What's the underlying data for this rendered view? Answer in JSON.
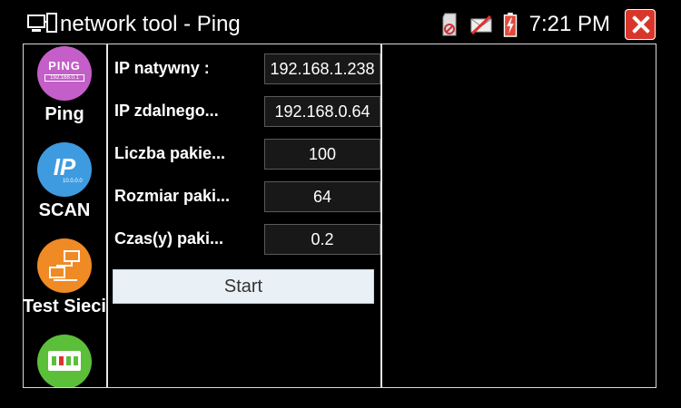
{
  "window": {
    "title": "network tool - Ping"
  },
  "status_bar": {
    "time": "7:21 PM",
    "icons": [
      "sd-card-icon",
      "mail-off-icon",
      "battery-charging-icon",
      "close-icon"
    ],
    "close_color": "#d9362b"
  },
  "sidebar": {
    "items": [
      {
        "label": "Ping",
        "icon": "ping-icon",
        "icon_text": "PING",
        "icon_sub": "192.168.0.1",
        "color": "#c45ec8"
      },
      {
        "label": "SCAN",
        "icon": "ip-scan-icon",
        "icon_text": "IP",
        "icon_sub": "10.0.0.0",
        "color": "#3f9be0"
      },
      {
        "label": "Test Sieci",
        "icon": "network-test-icon",
        "color": "#f08a24"
      },
      {
        "label": "",
        "icon": "port-icon",
        "color": "#5bbf3a"
      }
    ]
  },
  "form": {
    "fields": [
      {
        "label": "IP natywny :",
        "value": "192.168.1.238"
      },
      {
        "label": "IP zdalnego...",
        "value": "192.168.0.64"
      },
      {
        "label": "Liczba pakie...",
        "value": "100"
      },
      {
        "label": "Rozmiar paki...",
        "value": "64"
      },
      {
        "label": "Czas(y) paki...",
        "value": "0.2"
      }
    ],
    "start_label": "Start"
  }
}
